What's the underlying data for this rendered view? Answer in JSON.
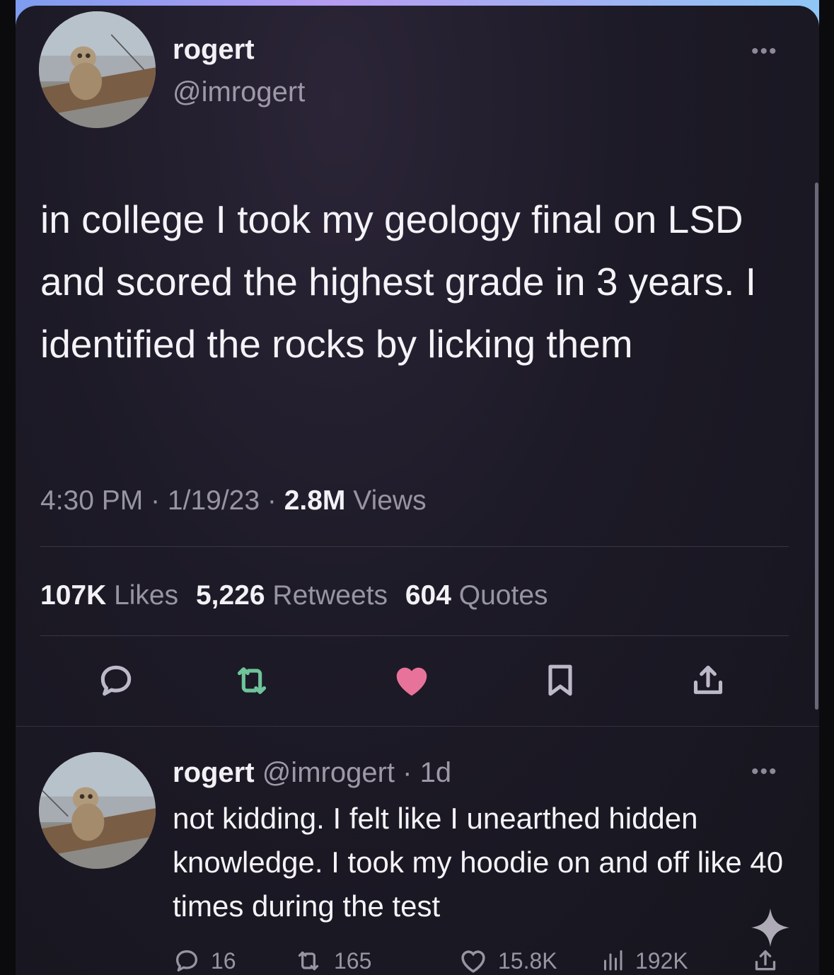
{
  "main_tweet": {
    "author_name": "rogert",
    "author_handle": "@imrogert",
    "text": "in college I took my geology final on LSD and scored the highest grade in 3 years. I identified the rocks by licking them",
    "time": "4:30 PM",
    "date": "1/19/23",
    "views_count": "2.8M",
    "views_label": "Views",
    "likes_count": "107K",
    "likes_label": "Likes",
    "retweets_count": "5,226",
    "retweets_label": "Retweets",
    "quotes_count": "604",
    "quotes_label": "Quotes",
    "liked": true
  },
  "reply": {
    "author_name": "rogert",
    "author_handle": "@imrogert",
    "age": "1d",
    "text": "not kidding. I felt like I unearthed hidden knowledge. I took my hoodie on and off like 40 times during the test",
    "replies": "16",
    "retweets": "165",
    "likes": "15.8K",
    "views": "192K"
  },
  "icons": {
    "more": "more-horizontal-icon",
    "reply": "speech-bubble-icon",
    "retweet": "retweet-icon",
    "like": "heart-icon",
    "bookmark": "bookmark-icon",
    "share": "share-icon",
    "views": "bar-chart-icon",
    "grok": "sparkle-icon"
  },
  "colors": {
    "background": "#1d1a27",
    "text": "#f4f3f7",
    "muted": "#9895a3",
    "like_active": "#e8739a",
    "retweet": "#6fc49a",
    "border_gradient": "#b69cf2"
  }
}
